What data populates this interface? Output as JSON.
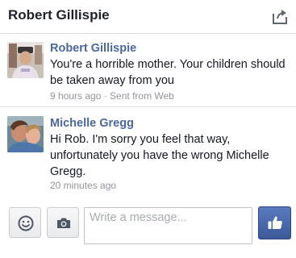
{
  "header": {
    "title": "Robert Gillispie",
    "share_icon": "share-icon"
  },
  "messages": [
    {
      "sender": "Robert Gillispie",
      "text": "You're a horrible mother. Your children should be taken away from you",
      "meta": "9 hours ago · Sent from Web"
    },
    {
      "sender": "Michelle Gregg",
      "text": "Hi Rob. I'm sorry you feel that way, unfortunately you have the wrong Michelle Gregg.",
      "meta": "20 minutes ago"
    }
  ],
  "composer": {
    "placeholder": "Write a message...",
    "emoji_icon": "smiley-icon",
    "camera_icon": "camera-icon",
    "like_icon": "thumbs-up-icon"
  },
  "colors": {
    "name": "#4b67a1",
    "like_button": "#3b5998",
    "meta": "#90949c"
  }
}
